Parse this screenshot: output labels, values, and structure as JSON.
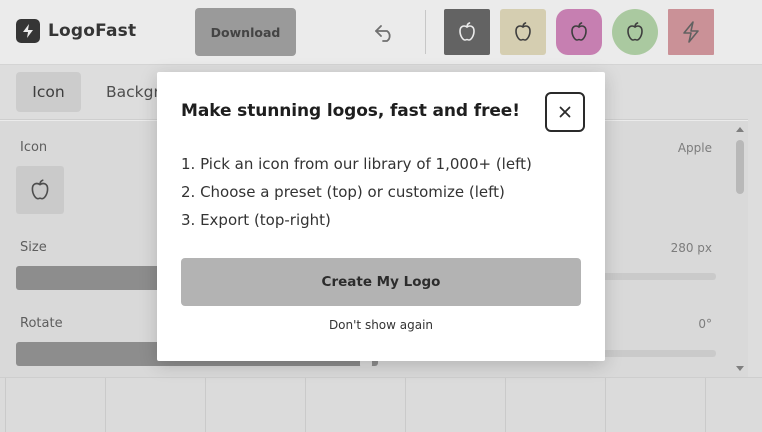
{
  "header": {
    "app_name": "LogoFast",
    "download_label": "Download",
    "presets": [
      {
        "icon": "apple-icon",
        "bg": "#6c6c6c",
        "fg": "#ffffff"
      },
      {
        "icon": "apple-icon",
        "bg": "#e8e0c0",
        "fg": "#444444"
      },
      {
        "icon": "apple-icon",
        "bg": "#d78ac0",
        "fg": "#444444"
      },
      {
        "icon": "apple-icon",
        "bg": "#b9dbae",
        "fg": "#444444"
      },
      {
        "icon": "bolt-icon",
        "bg": "#dc9ea4",
        "fg": "#6a6a6a"
      }
    ]
  },
  "tabs": [
    {
      "label": "Icon",
      "active": true
    },
    {
      "label": "Background",
      "active": false
    }
  ],
  "panel": {
    "icon_label": "Icon",
    "icon_value": "Apple",
    "size_label": "Size",
    "size_value": "280 px",
    "rotate_label": "Rotate",
    "rotate_value": "0°"
  },
  "modal": {
    "title": "Make stunning logos, fast and free!",
    "steps": [
      "1. Pick an icon from our library of 1,000+ (left)",
      "2. Choose a preset (top) or customize (left)",
      "3. Export (top-right)"
    ],
    "primary_button": "Create My Logo",
    "dismiss_link": "Don't show again"
  },
  "colors": {
    "accent_gray": "#b3b3b3",
    "text_dark": "#1e1e1e"
  }
}
